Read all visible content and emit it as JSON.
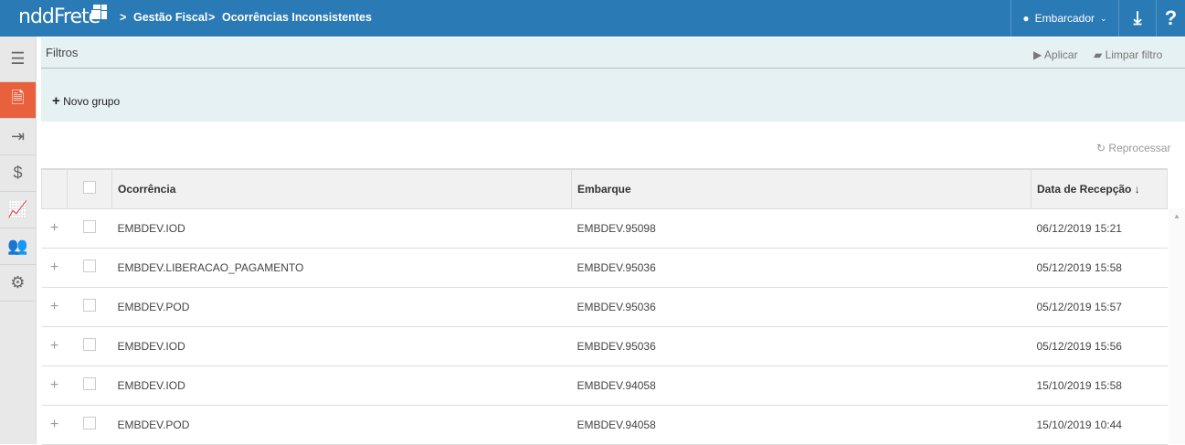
{
  "header": {
    "logo": "nddFrete",
    "breadcrumb": [
      "Gestão Fiscal",
      "Ocorrências Inconsistentes"
    ],
    "user": "Embarcador"
  },
  "filters": {
    "title": "Filtros",
    "apply": "Aplicar",
    "clear": "Limpar filtro",
    "new_group": "Novo grupo"
  },
  "toolbar": {
    "reprocess": "Reprocessar"
  },
  "table": {
    "columns": [
      "Ocorrência",
      "Embarque",
      "Data de Recepção ↓"
    ],
    "rows": [
      [
        "EMBDEV.IOD",
        "EMBDEV.95098",
        "06/12/2019 15:21"
      ],
      [
        "EMBDEV.LIBERACAO_PAGAMENTO",
        "EMBDEV.95036",
        "05/12/2019 15:58"
      ],
      [
        "EMBDEV.POD",
        "EMBDEV.95036",
        "05/12/2019 15:57"
      ],
      [
        "EMBDEV.IOD",
        "EMBDEV.95036",
        "05/12/2019 15:56"
      ],
      [
        "EMBDEV.IOD",
        "EMBDEV.94058",
        "15/10/2019 15:58"
      ],
      [
        "EMBDEV.POD",
        "EMBDEV.94058",
        "15/10/2019 10:44"
      ]
    ]
  }
}
